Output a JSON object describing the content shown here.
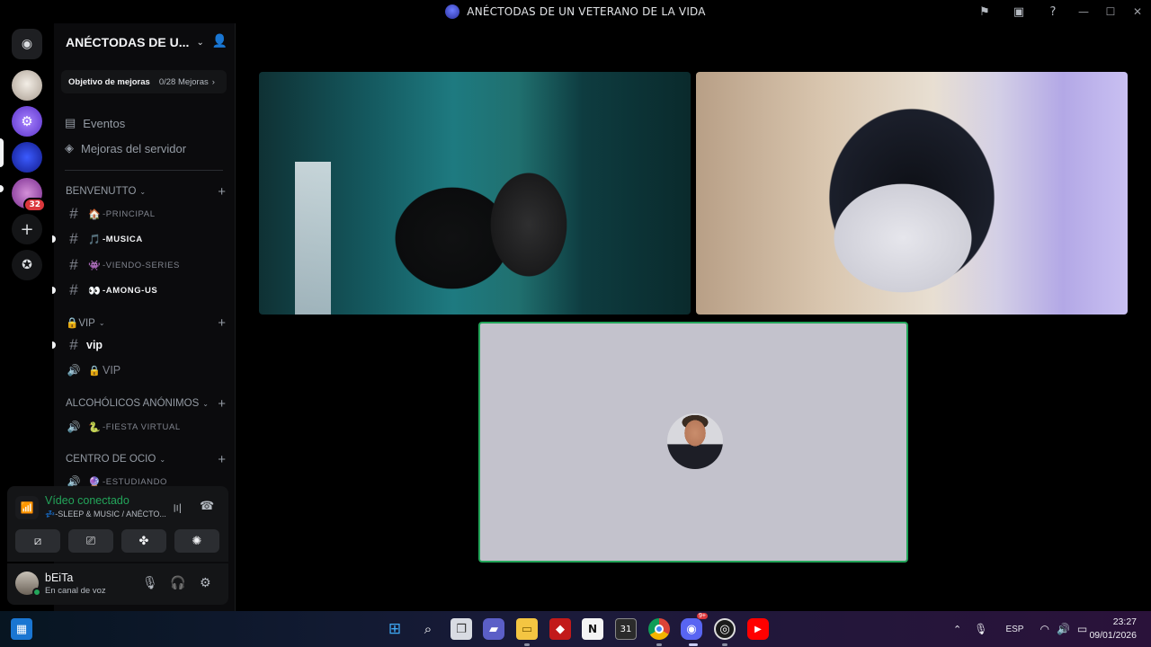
{
  "window": {
    "title": "ANÉCTODAS DE UN VETERANO DE LA VIDA"
  },
  "server": {
    "name": "ANÉCTODAS DE U...",
    "boost_goal_label": "Objetivo de mejoras",
    "boost_goal_count": "0/28 Mejoras"
  },
  "rail": {
    "badge": "32"
  },
  "nav": {
    "events": "Eventos",
    "boosts": "Mejoras del servidor"
  },
  "categories": [
    {
      "name": "BENVENUTTO"
    },
    {
      "name": "🔒VIP"
    },
    {
      "name": "ALCOHÓLICOS ANÓNIMOS"
    },
    {
      "name": "CENTRO DE OCIO"
    }
  ],
  "channels": [
    {
      "emoji": "🏠",
      "name": "-PRINCIPAL",
      "type": "text",
      "unread": false
    },
    {
      "emoji": "🎵",
      "name": "-MUSICA",
      "type": "text",
      "unread": true
    },
    {
      "emoji": "👾",
      "name": "-VIENDO-SERIES",
      "type": "text",
      "unread": false
    },
    {
      "emoji": "👀",
      "name": "-AMONG-US",
      "type": "text",
      "unread": true
    },
    {
      "emoji": "",
      "name": "vip",
      "type": "text",
      "unread": true
    },
    {
      "emoji": "🔒",
      "name": "VIP",
      "type": "voice",
      "unread": false
    },
    {
      "emoji": "🐍",
      "name": "-FIESTA VIRTUAL",
      "type": "voice",
      "unread": false
    },
    {
      "emoji": "🔮",
      "name": "-ESTUDIANDO",
      "type": "voice",
      "unread": false
    }
  ],
  "voice": {
    "status": "Vídeo conectado",
    "channel": "💤-SLEEP & MUSIC / ANÉCTO..."
  },
  "user": {
    "name": "bEiTa",
    "status": "En canal de voz"
  },
  "taskbar": {
    "lang": "ESP",
    "time": "23:27",
    "date": "09/01/2026",
    "calendar_day": "31",
    "discord_badge": "9+"
  },
  "colors": {
    "accent_green": "#23a55a",
    "danger_red": "#da373c",
    "background": "#000000"
  }
}
